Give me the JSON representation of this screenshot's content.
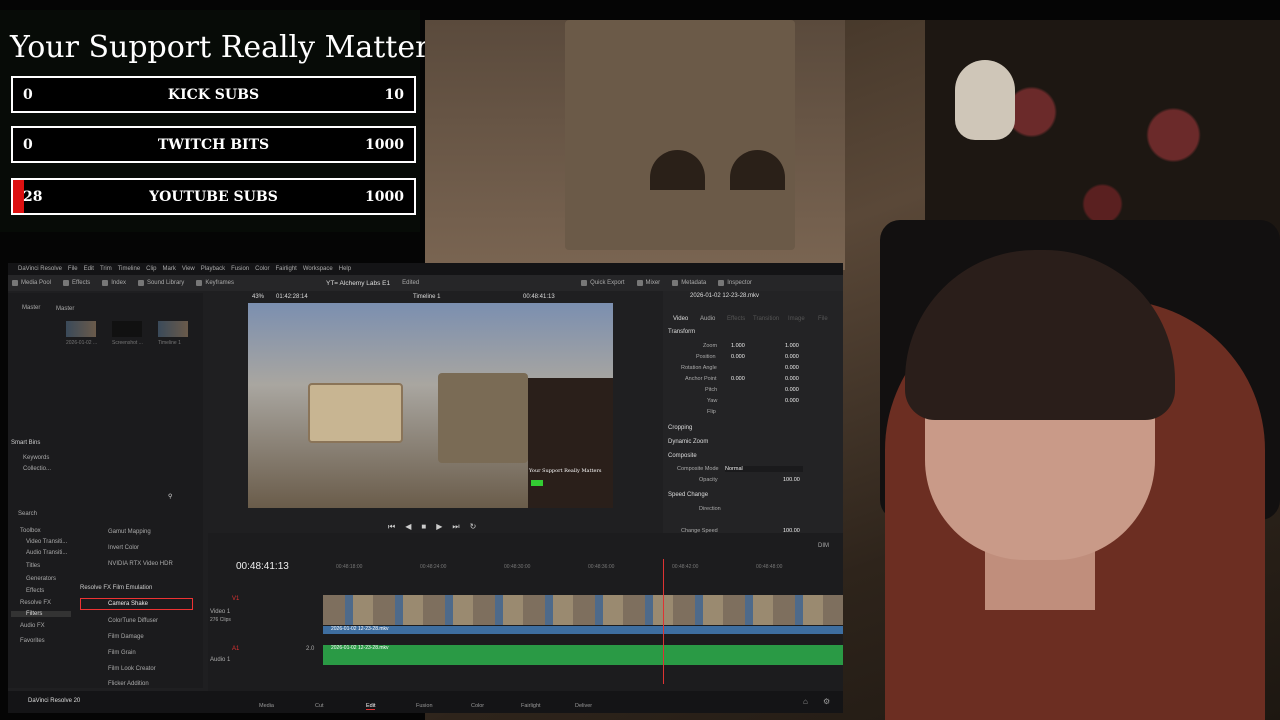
{
  "overlay": {
    "title": "Your Support Really Matters",
    "goals": [
      {
        "label": "KICK SUBS",
        "current": "0",
        "target": "10",
        "fraction": 0.0
      },
      {
        "label": "TWITCH BITS",
        "current": "0",
        "target": "1000",
        "fraction": 0.0
      },
      {
        "label": "YOUTUBE SUBS",
        "current": "28",
        "target": "1000",
        "fraction": 0.028
      }
    ]
  },
  "resolve": {
    "menu": [
      "DaVinci Resolve",
      "File",
      "Edit",
      "Trim",
      "Timeline",
      "Clip",
      "Mark",
      "View",
      "Playback",
      "Fusion",
      "Color",
      "Fairlight",
      "Workspace",
      "Help"
    ],
    "project_title": "YT= Alchemy Labs E1",
    "project_status": "Edited",
    "toolbar": [
      "Media Pool",
      "Effects",
      "Index",
      "Sound Library",
      "Keyframes",
      "Quick Export",
      "Mixer",
      "Metadata",
      "Inspector"
    ],
    "left_tabs": [
      "Master",
      "Master"
    ],
    "clips": [
      "2026-01-02 ...",
      "Screenshot ...",
      "Timeline 1"
    ],
    "smart_bins": "Smart Bins",
    "smart_bin_items": [
      "Keywords",
      "Collectio..."
    ],
    "search_placeholder": "Search",
    "toolbox": [
      "Toolbox",
      "Video Transiti...",
      "Audio Transiti...",
      "Titles",
      "Generators",
      "Effects"
    ],
    "openfx": [
      "Resolve FX",
      "Filters",
      "Audio FX",
      "Favorites"
    ],
    "fx_items": [
      "Gamut Mapping",
      "Invert Color",
      "NVIDIA RTX Video HDR",
      "Camera Shake",
      "ColorTune Diffuser",
      "Film Damage",
      "Film Grain",
      "Film Look Creator",
      "Flicker Addition"
    ],
    "fx_section": "Resolve FX Film Emulation",
    "viewer": {
      "zoom": "43%",
      "source_tc": "01:42:28:14",
      "timeline_name": "Timeline 1",
      "record_tc": "00:48:41:13"
    },
    "inspector": {
      "clip_name": "2026-01-02 12-23-28.mkv",
      "tabs": [
        "Video",
        "Audio",
        "Effects",
        "Transition",
        "Image",
        "File"
      ],
      "transform": "Transform",
      "rows": [
        {
          "label": "Zoom",
          "x": "1.000",
          "y": "1.000"
        },
        {
          "label": "Position",
          "x": "0.000",
          "y": "0.000"
        },
        {
          "label": "Rotation Angle",
          "v": "0.000"
        },
        {
          "label": "Anchor Point",
          "x": "0.000",
          "y": "0.000"
        },
        {
          "label": "Pitch",
          "v": "0.000"
        },
        {
          "label": "Yaw",
          "v": "0.000"
        },
        {
          "label": "Flip",
          "v": ""
        }
      ],
      "sections": [
        "Cropping",
        "Dynamic Zoom",
        "Composite",
        "Speed Change"
      ],
      "composite_mode_label": "Composite Mode",
      "composite_mode": "Normal",
      "opacity_label": "Opacity",
      "opacity": "100.00",
      "direction_label": "Direction",
      "change_speed_label": "Change Speed",
      "change_speed": "100.00"
    },
    "timeline": {
      "timecode": "00:48:41:13",
      "ruler": [
        "00:48:18:00",
        "00:48:24:00",
        "00:48:30:00",
        "00:48:36:00",
        "00:48:42:00",
        "00:48:48:00"
      ],
      "video_track": "Video 1",
      "video_clips_count": "276 Clips",
      "v_label": "V1",
      "a_label": "A1",
      "audio_track": "Audio 1",
      "audio_level": "2.0",
      "clip_file": "2026-01-02 12-23-28.mkv",
      "volume": "DIM"
    },
    "pages": [
      "Media",
      "Cut",
      "Edit",
      "Fusion",
      "Color",
      "Fairlight",
      "Deliver"
    ],
    "active_page": "Edit",
    "app_name": "DaVinci Resolve 20"
  },
  "viewer_overlay_text": "Your Support Really Matters"
}
